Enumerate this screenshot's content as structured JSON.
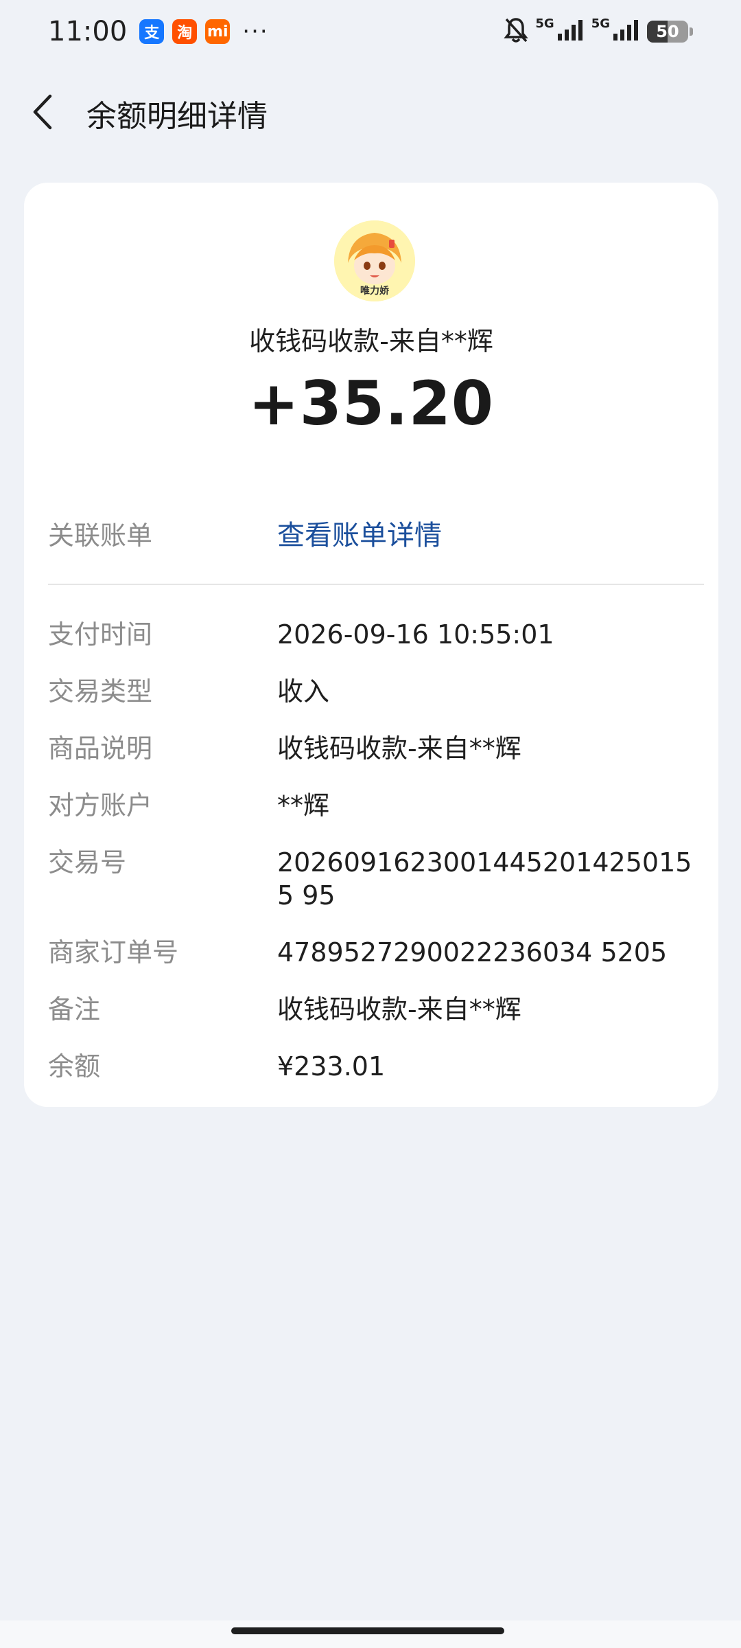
{
  "status_bar": {
    "time": "11:00",
    "apps": [
      {
        "icon": "alipay-icon",
        "glyph": "支"
      },
      {
        "icon": "taobao-icon",
        "glyph": "淘"
      },
      {
        "icon": "mi-icon",
        "glyph": "mi"
      }
    ],
    "more": "···",
    "net1": "5G",
    "net2": "5G",
    "battery": "50"
  },
  "header": {
    "title": "余额明细详情",
    "back_icon": "chevron-left-icon"
  },
  "summary": {
    "avatar_caption": "唯力娇",
    "title": "收钱码收款-来自**辉",
    "amount": "+35.20"
  },
  "related_bill": {
    "label": "关联账单",
    "link": "查看账单详情"
  },
  "details": [
    {
      "label": "支付时间",
      "value": "2026-09-16 10:55:01"
    },
    {
      "label": "交易类型",
      "value": "收入"
    },
    {
      "label": "商品说明",
      "value": "收钱码收款-来自**辉"
    },
    {
      "label": "对方账户",
      "value": "**辉"
    },
    {
      "label": "交易号",
      "value": "20260916230014452014250155 95"
    },
    {
      "label": "商家订单号",
      "value": "4789527290022236034 5205"
    },
    {
      "label": "备注",
      "value": "收钱码收款-来自**辉"
    },
    {
      "label": "余额",
      "value": "¥233.01"
    }
  ],
  "colors": {
    "background": "#eff2f7",
    "card": "#ffffff",
    "link": "#1b4f9c",
    "label": "#8c8c8c"
  }
}
